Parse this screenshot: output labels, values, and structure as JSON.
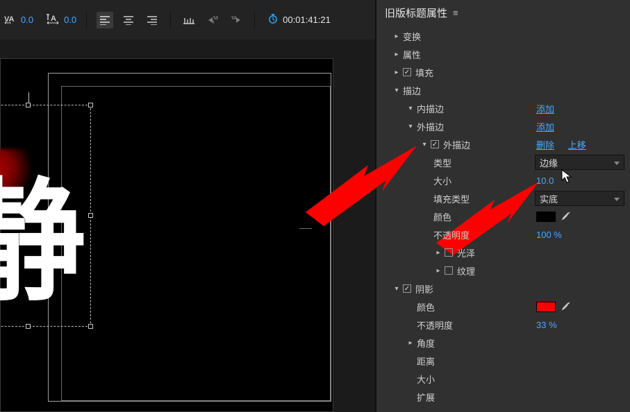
{
  "toolbar": {
    "kerning_value": "0.0",
    "tracking_value": "0.0",
    "timecode": "00:01:41:21"
  },
  "preview": {
    "character": "静"
  },
  "panel": {
    "title": "旧版标题属性",
    "sections": {
      "transform": "变换",
      "properties": "属性",
      "fill": "填充",
      "stroke": "描边",
      "inner_stroke": "内描边",
      "inner_stroke_add": "添加",
      "outer_stroke": "外描边",
      "outer_stroke_add": "添加",
      "outer_stroke_item": "外描边",
      "outer_stroke_delete": "删除",
      "outer_stroke_up": "上移",
      "type_label": "类型",
      "type_value": "边缘",
      "size_label": "大小",
      "size_value": "10.0",
      "filltype_label": "填充类型",
      "filltype_value": "实底",
      "color_label": "颜色",
      "opacity_label": "不透明度",
      "opacity_value": "100 %",
      "sheen": "光泽",
      "texture": "纹理",
      "shadow": "阴影",
      "shadow_color": "颜色",
      "shadow_opacity_label": "不透明度",
      "shadow_opacity_value": "33 %",
      "shadow_angle": "角度",
      "shadow_distance": "距离",
      "shadow_size": "大小",
      "shadow_spread": "扩展"
    },
    "colors": {
      "stroke_swatch": "#000000",
      "shadow_swatch": "#ff0000"
    }
  }
}
